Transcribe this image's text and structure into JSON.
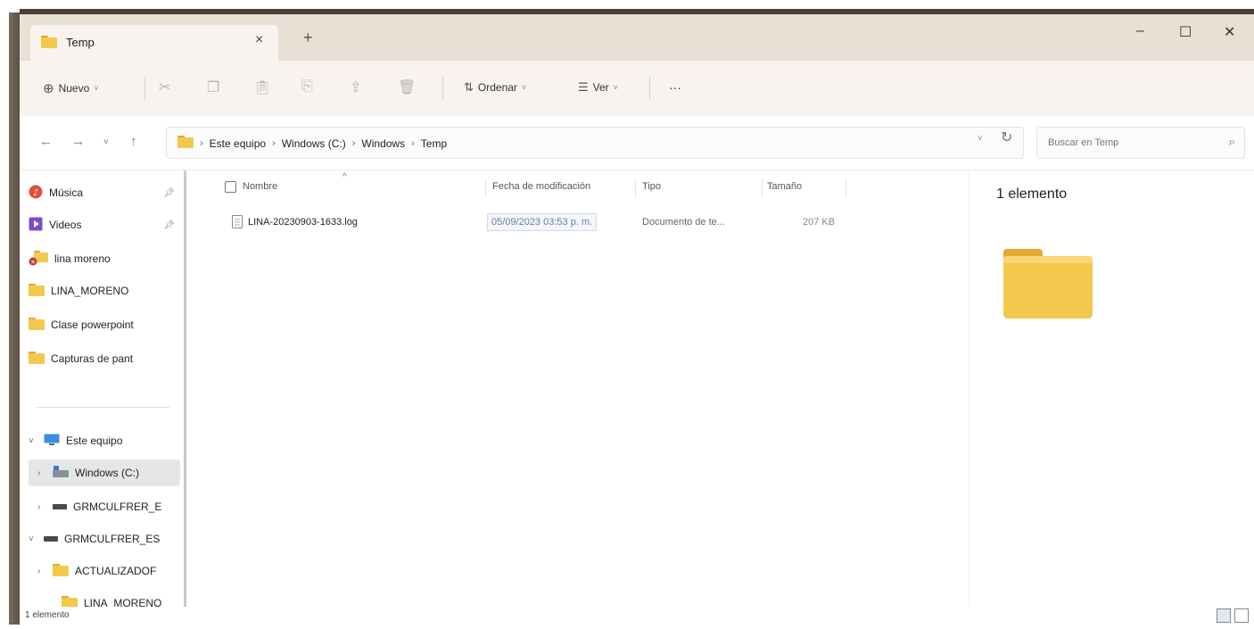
{
  "window": {
    "tab_title": "Temp",
    "tab_close": "×",
    "tab_new": "+",
    "minimize": "–",
    "maximize": "☐",
    "close": "✕"
  },
  "commandbar": {
    "new_label": "Nuevo",
    "sort_label": "Ordenar",
    "view_label": "Ver",
    "more_label": "···"
  },
  "address": {
    "crumbs": [
      "Este equipo",
      "Windows (C:)",
      "Windows",
      "Temp"
    ],
    "search_placeholder": "Buscar en Temp"
  },
  "nav": {
    "quick": [
      {
        "label": "Música",
        "icon": "music-icon",
        "pinned": true
      },
      {
        "label": "Videos",
        "icon": "video-icon",
        "pinned": true
      },
      {
        "label": "lina moreno",
        "icon": "folder-error-icon",
        "pinned": false
      },
      {
        "label": "LINA_MORENO",
        "icon": "folder-icon",
        "pinned": false
      },
      {
        "label": "Clase powerpoint",
        "icon": "folder-icon",
        "pinned": false
      },
      {
        "label": "Capturas de pant",
        "icon": "folder-icon",
        "pinned": false
      }
    ],
    "tree": [
      {
        "label": "Este equipo",
        "icon": "computer-icon",
        "chevron": "expanded"
      },
      {
        "label": "Windows (C:)",
        "icon": "drive-icon",
        "chevron": "collapsed",
        "selected": true
      },
      {
        "label": "GRMCULFRER_E",
        "icon": "usb-drive-icon",
        "chevron": "collapsed"
      },
      {
        "label": "GRMCULFRER_ES",
        "icon": "usb-drive-icon",
        "chevron": "expanded"
      },
      {
        "label": "ACTUALIZADOF",
        "icon": "folder-icon",
        "chevron": "collapsed"
      },
      {
        "label": "LINA_MORENO",
        "icon": "folder-icon",
        "chevron": "none"
      }
    ]
  },
  "files": {
    "columns": {
      "name": "Nombre",
      "modified": "Fecha de modificación",
      "type": "Tipo",
      "size": "Tamaño"
    },
    "rows": [
      {
        "name": "LINA-20230903-1633.log",
        "modified": "05/09/2023 03:53 p. m.",
        "type": "Documento de te...",
        "size": "207 KB"
      }
    ]
  },
  "details": {
    "count": "1 elemento"
  },
  "status": {
    "count": "1 elemento"
  },
  "colors": {
    "folder": "#f2c94c",
    "folder_dark": "#e3a92c",
    "title_bar": "#e8e0d4",
    "command_bar": "#f7f3ee",
    "selection": "#e6e6e6"
  }
}
